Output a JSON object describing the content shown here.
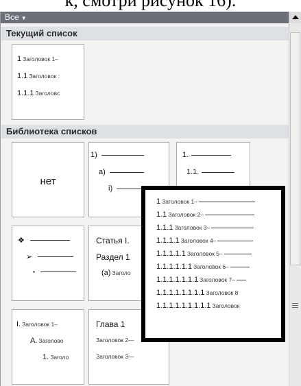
{
  "caption": "к, смотри рисунок 16).",
  "filter": {
    "label": "Все"
  },
  "sections": {
    "current": "Текущий список",
    "library": "Библиотека списков"
  },
  "current_list": [
    {
      "num": "1",
      "text": "Заголовок 1–"
    },
    {
      "num": "1.1",
      "text": "Заголовок :"
    },
    {
      "num": "1.1.1",
      "text": "Заголовс"
    }
  ],
  "tiles": {
    "none": "нет",
    "numbered_paren": [
      "1)",
      "a)",
      "i)"
    ],
    "numbered_dots": [
      "1.",
      "1.1."
    ],
    "bullets": [
      "❖",
      "➢",
      "▪"
    ],
    "article": [
      {
        "num": "Статья I.",
        "text": ""
      },
      {
        "num": "Раздел 1",
        "text": ""
      },
      {
        "num": "(а)",
        "text": "Заголо"
      }
    ],
    "roman": [
      {
        "num": "I.",
        "text": "Заголовок 1–"
      },
      {
        "num": "A.",
        "text": "Заголово"
      },
      {
        "num": "1.",
        "text": "Заголо"
      }
    ],
    "chapter": [
      {
        "num": "Глава 1",
        "text": ""
      },
      {
        "num": "",
        "text": "Заголовок 2—"
      },
      {
        "num": "",
        "text": "Заголовок 3—"
      }
    ]
  },
  "popup": [
    {
      "num": "1",
      "text": "Заголовок 1–"
    },
    {
      "num": "1.1",
      "text": "Заголовок 2–"
    },
    {
      "num": "1.1.1",
      "text": "Заголовок 3–"
    },
    {
      "num": "1.1.1.1",
      "text": "Заголовок 4–"
    },
    {
      "num": "1.1.1.1.1",
      "text": "Заголовок 5–"
    },
    {
      "num": "1.1.1.1.1.1",
      "text": "Заголовок 6–"
    },
    {
      "num": "1.1.1.1.1.1.1",
      "text": "Заголовок 7–"
    },
    {
      "num": "1.1.1.1.1.1.1.1",
      "text": "Заголовок 8"
    },
    {
      "num": "1.1.1.1.1.1.1.1.1",
      "text": "Заголовок"
    }
  ]
}
